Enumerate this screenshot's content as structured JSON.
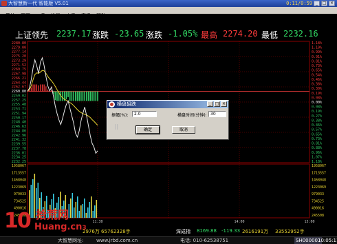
{
  "window": {
    "title": "大智慧新一代 智能版  V5.01",
    "clock": "0:11/0:59",
    "min_label": "_",
    "max_label": "□",
    "close_label": "×"
  },
  "menu": [
    "系统",
    "画面",
    "工具",
    "选股",
    "查看",
    "资讯",
    "帮助"
  ],
  "quote": {
    "name": "上证领先",
    "price": "2237.17",
    "change_label": "涨跌",
    "change": "-23.65",
    "pct_label": "涨跌",
    "pct": "-1.05%",
    "high_label": "最高",
    "high": "2274.20",
    "low_label": "最低",
    "low": "2232.16"
  },
  "colors": {
    "up": "#ff3b3b",
    "down": "#33cc66",
    "frame": "#8b0000",
    "line_white": "#e8e8e8",
    "line_yellow": "#e6d230",
    "vol_cyan": "#36c8e0",
    "vol_yellow": "#e0d040"
  },
  "chart_data": {
    "type": "line",
    "prev_close": "2260.80",
    "price_ticks_left": [
      "2280.80",
      "2279.00",
      "2277.14",
      "2275.20",
      "2273.29",
      "2271.52",
      "2269.75",
      "2267.98",
      "2266.21",
      "2264.44",
      "2262.67",
      "2260.80",
      "2259.02",
      "2257.25",
      "2255.48",
      "2253.71",
      "2251.94",
      "2250.17",
      "2248.40",
      "2246.63",
      "2244.86",
      "2242.96",
      "2241.32",
      "2239.55",
      "2237.78",
      "2236.01",
      "2234.25",
      "2232.25"
    ],
    "pct_ticks_right": [
      "1.18%",
      "1.10%",
      "0.99%",
      "0.91%",
      "0.81%",
      "0.73%",
      "0.65%",
      "0.54%",
      "0.46%",
      "0.38%",
      "0.30%",
      "0.19%",
      "0.08%",
      "0.00%",
      "0.08%",
      "0.19%",
      "0.27%",
      "0.38%",
      "0.46%",
      "0.57%",
      "0.65%",
      "0.73%",
      "0.81%",
      "0.88%",
      "0.96%",
      "1.07%",
      "1.18%"
    ],
    "volume_ticks_left": [
      "1958067",
      "1713557",
      "1468048",
      "1223069",
      "979033",
      "734525",
      "490016",
      "245508"
    ],
    "volume_ticks_right": [
      "1958067",
      "1713557",
      "1468048",
      "1223069",
      "979033",
      "734525",
      "490016",
      "245508"
    ],
    "x_ticks": [
      "11:30",
      "14:00",
      "15:00"
    ],
    "price_series": [
      2260.8,
      2262.0,
      2265.5,
      2270.2,
      2273.4,
      2271.0,
      2268.0,
      2272.5,
      2274.2,
      2271.0,
      2266.8,
      2263.0,
      2261.0,
      2262.5,
      2259.0,
      2255.0,
      2252.0,
      2249.5,
      2247.5,
      2250.0,
      2253.0,
      2255.5,
      2257.0,
      2254.0,
      2251.0,
      2248.0,
      2244.0,
      2242.5,
      2245.0,
      2249.0,
      2252.0,
      2254.5,
      2251.0,
      2247.0,
      2243.0,
      2240.0,
      2238.5,
      2236.0,
      2237.0
    ],
    "avg_series": [
      2260.8,
      2261.5,
      2263.0,
      2265.5,
      2267.5,
      2268.2,
      2268.0,
      2268.5,
      2269.2,
      2269.0,
      2268.0,
      2266.8,
      2265.8,
      2265.0,
      2264.0,
      2262.8,
      2261.5,
      2260.3,
      2259.0,
      2258.2,
      2257.6,
      2257.2,
      2256.8,
      2256.3,
      2255.8,
      2255.1,
      2254.3,
      2253.5,
      2252.8,
      2252.3,
      2251.9,
      2251.6,
      2251.3,
      2250.9,
      2250.3,
      2249.5,
      2248.8,
      2248.0,
      2247.2
    ]
  },
  "footer": {
    "stats": "2976万   65762328手",
    "index_label": "深成指",
    "index_value": "8169.88",
    "index_change": "-119.33",
    "index_amount": "2616191万",
    "index_vol": "33552952手",
    "site_label": "大智慧网址:",
    "site": "www.jrbd.com.cn",
    "phone": "电话: 010-62538751",
    "code": "SH000001",
    "time": "10:05:11"
  },
  "watermark": {
    "num": "10",
    "cn": "拾荒网",
    "url": "Huang.cn",
    "sub": "3"
  },
  "dialog": {
    "title": "横盘狙跌",
    "amp_label": "振幅(%):",
    "amp_value": "2.0",
    "time_label": "横盘时间(分钟):",
    "time_value": "30",
    "ok": "确定",
    "cancel": "取消"
  }
}
